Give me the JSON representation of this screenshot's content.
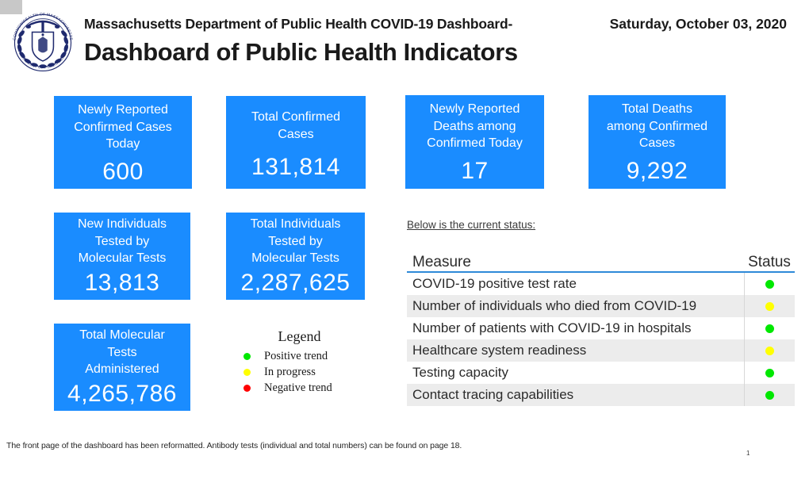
{
  "header": {
    "title": "Massachusetts Department of Public Health COVID-19 Dashboard-",
    "date": "Saturday, October 03, 2020",
    "subtitle": "Dashboard of Public Health Indicators",
    "seal_icon": "massachusetts-dph-seal-icon",
    "seal_outer_text": "COMMONWEALTH OF MASSACHUSETTS",
    "seal_inner_text": "DEPARTMENT OF PUBLIC HEALTH"
  },
  "cards": [
    {
      "id": "new-cases",
      "label": "Newly Reported\nConfirmed Cases\nToday",
      "value": "600"
    },
    {
      "id": "total-cases",
      "label": "Total Confirmed\nCases",
      "value": "131,814"
    },
    {
      "id": "new-deaths",
      "label": "Newly Reported\nDeaths among\nConfirmed Today",
      "value": "17"
    },
    {
      "id": "total-deaths",
      "label": "Total Deaths\namong Confirmed\nCases",
      "value": "9,292"
    },
    {
      "id": "new-tested",
      "label": "New Individuals\nTested by\nMolecular Tests",
      "value": "13,813"
    },
    {
      "id": "total-tested",
      "label": "Total Individuals\nTested by\nMolecular Tests",
      "value": "2,287,625"
    },
    {
      "id": "total-molecular",
      "label": "Total Molecular\nTests\nAdministered",
      "value": "4,265,786"
    }
  ],
  "legend": {
    "title": "Legend",
    "items": [
      {
        "label": "Positive trend",
        "color": "#00e800",
        "icon": "green-dot-icon"
      },
      {
        "label": "In progress",
        "color": "#ffff00",
        "icon": "yellow-dot-icon"
      },
      {
        "label": "Negative trend",
        "color": "#ff0000",
        "icon": "red-dot-icon"
      }
    ]
  },
  "status": {
    "note": "Below is the current status:",
    "columns": {
      "measure": "Measure",
      "status": "Status"
    },
    "rows": [
      {
        "measure": "COVID-19 positive test rate",
        "status": "positive",
        "color": "#00e800"
      },
      {
        "measure": "Number of individuals who died from COVID-19",
        "status": "in-progress",
        "color": "#ffff00"
      },
      {
        "measure": "Number of patients with COVID-19 in hospitals",
        "status": "positive",
        "color": "#00e800"
      },
      {
        "measure": "Healthcare system readiness",
        "status": "in-progress",
        "color": "#ffff00"
      },
      {
        "measure": "Testing capacity",
        "status": "positive",
        "color": "#00e800"
      },
      {
        "measure": "Contact tracing capabilities",
        "status": "positive",
        "color": "#00e800"
      }
    ]
  },
  "footer": {
    "note": "The front page of the dashboard has been reformatted. Antibody tests (individual and total numbers) can be found on page 18.",
    "page_number": "1"
  },
  "colors": {
    "card_blue": "#1a8cff",
    "header_rule_blue": "#2e8ad8",
    "row_alt_gray": "#ececec",
    "seal_navy": "#1f2a6e"
  }
}
